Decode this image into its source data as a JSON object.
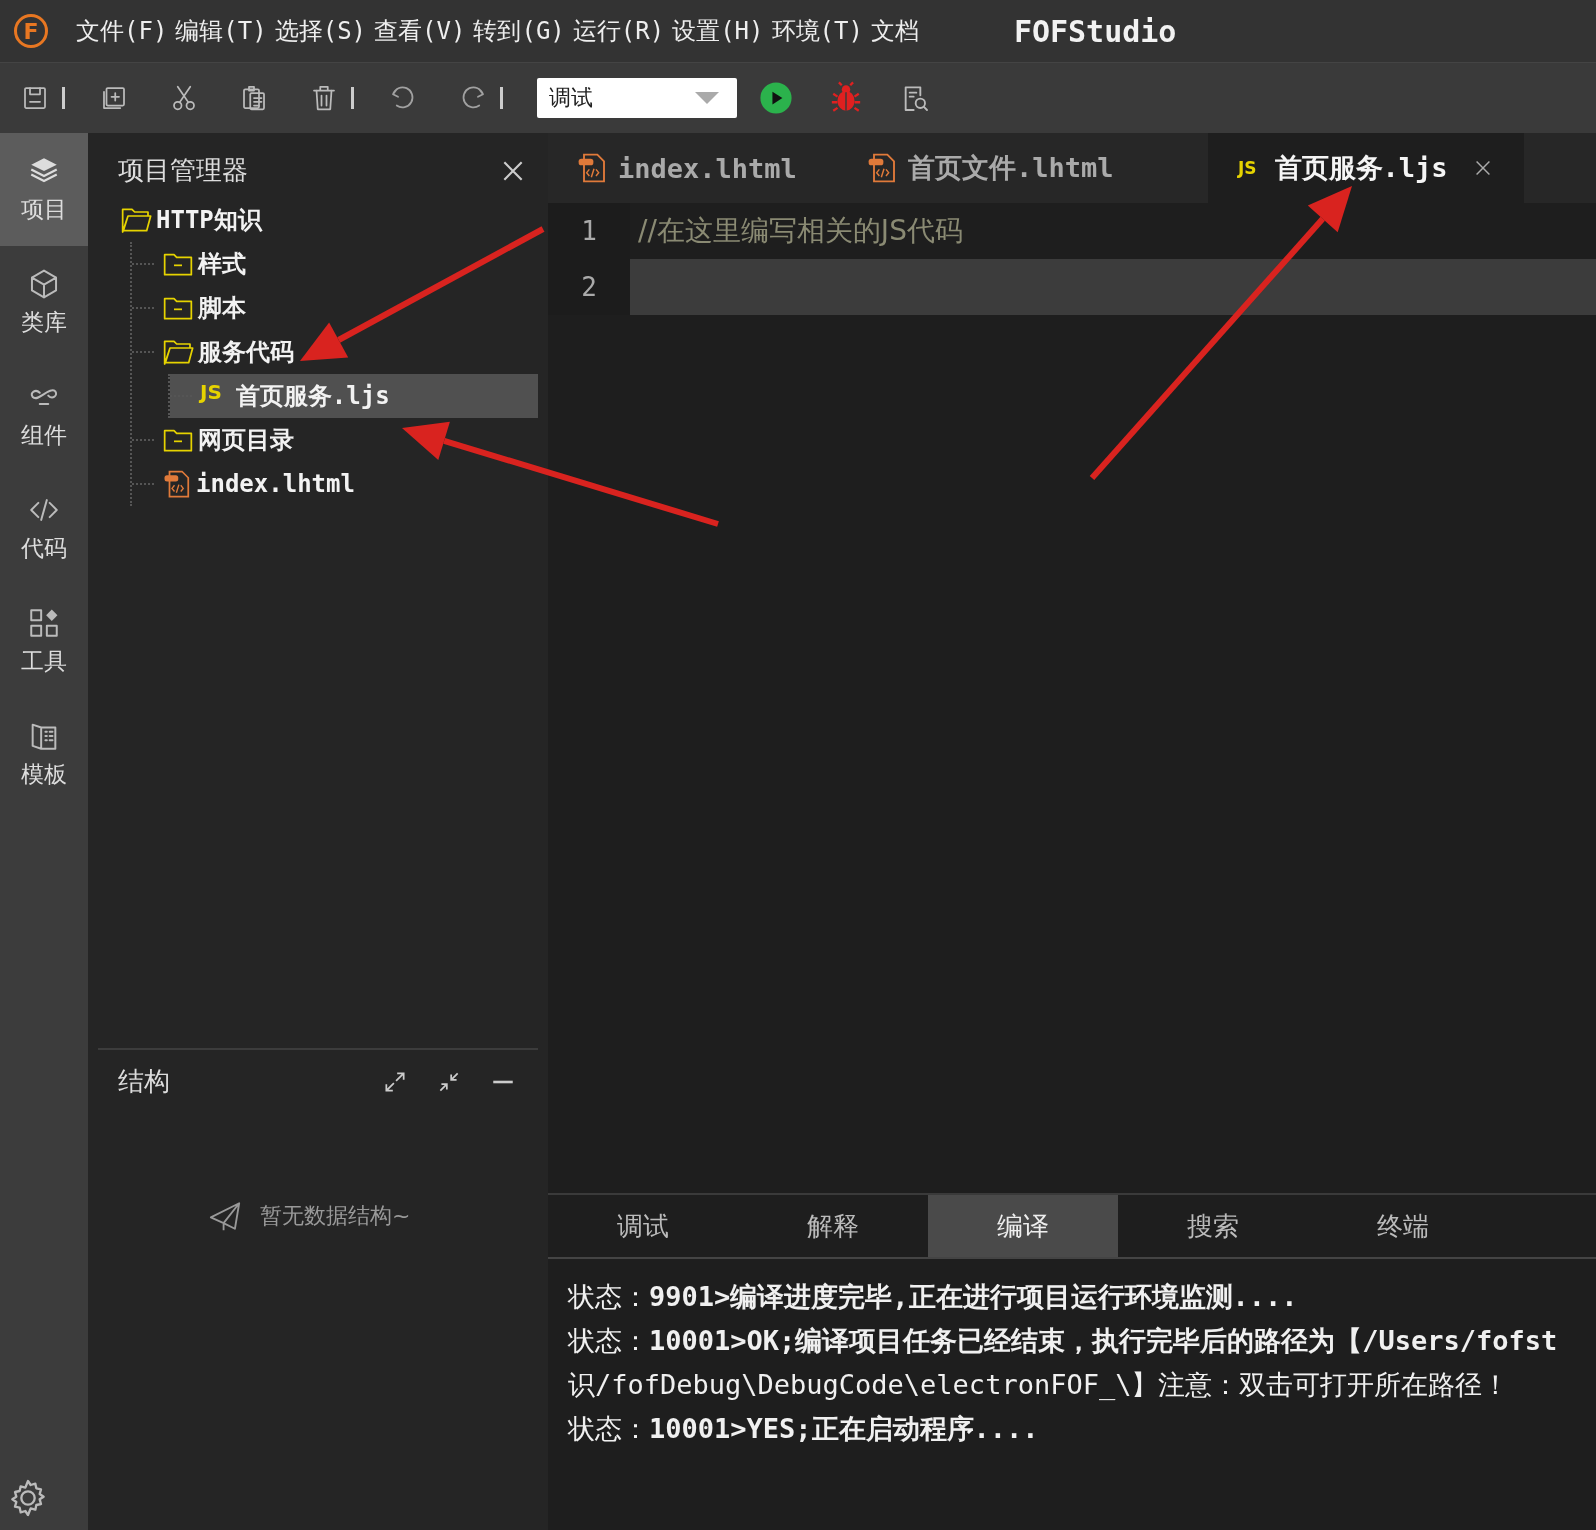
{
  "menu_bar": {
    "logo": "F",
    "items": [
      "文件(F)",
      "编辑(T)",
      "选择(S)",
      "查看(V)",
      "转到(G)",
      "运行(R)",
      "设置(H)",
      "环境(T)",
      "文档"
    ],
    "app_title": "FOFStudio"
  },
  "toolbar": {
    "mode_select": {
      "value": "调试"
    }
  },
  "activity_bar": {
    "items": [
      {
        "label": "项目",
        "selected": true
      },
      {
        "label": "类库",
        "selected": false
      },
      {
        "label": "组件",
        "selected": false
      },
      {
        "label": "代码",
        "selected": false
      },
      {
        "label": "工具",
        "selected": false
      },
      {
        "label": "模板",
        "selected": false
      }
    ]
  },
  "explorer": {
    "title": "项目管理器",
    "tree": [
      {
        "label": "HTTP知识",
        "kind": "folder",
        "expanded": true,
        "selected": false,
        "children": [
          {
            "label": "样式",
            "kind": "folder",
            "expanded": false,
            "selected": false
          },
          {
            "label": "脚本",
            "kind": "folder",
            "expanded": false,
            "selected": false
          },
          {
            "label": "服务代码",
            "kind": "folder",
            "expanded": true,
            "selected": false,
            "children": [
              {
                "label": "首页服务.ljs",
                "kind": "js",
                "badge": "JS",
                "selected": true
              }
            ]
          },
          {
            "label": "网页目录",
            "kind": "folder",
            "expanded": false,
            "selected": false
          },
          {
            "label": "index.lhtml",
            "kind": "html",
            "selected": false
          }
        ]
      }
    ]
  },
  "structure": {
    "title": "结构",
    "empty_text": "暂无数据结构~"
  },
  "editor": {
    "tabs": [
      {
        "label": "index.lhtml",
        "kind": "html",
        "selected": false
      },
      {
        "label": "首页文件.lhtml",
        "kind": "html",
        "selected": false
      },
      {
        "label": "首页服务.ljs",
        "kind": "js",
        "badge": "JS",
        "selected": true
      }
    ],
    "lines": [
      {
        "number": "1",
        "text": "//在这里编写相关的JS代码",
        "current": false
      },
      {
        "number": "2",
        "current": true
      }
    ]
  },
  "panel": {
    "tabs": [
      {
        "label": "调试",
        "selected": false
      },
      {
        "label": "解释",
        "selected": false
      },
      {
        "label": "编译",
        "selected": true
      },
      {
        "label": "搜索",
        "selected": false
      },
      {
        "label": "终端",
        "selected": false
      }
    ],
    "log": [
      "状态：**9901>编译进度完毕,正在进行项目运行环境监测....**",
      "状态：**10001>OK;编译项目任务已经结束，执行完毕后的路径为【/Users/fofst**",
      "识/fofDebug\\DebugCode\\electronFOF_\\】注意：双击可打开所在路径！",
      "状态：**10001>YES;正在启动程序....**"
    ]
  }
}
